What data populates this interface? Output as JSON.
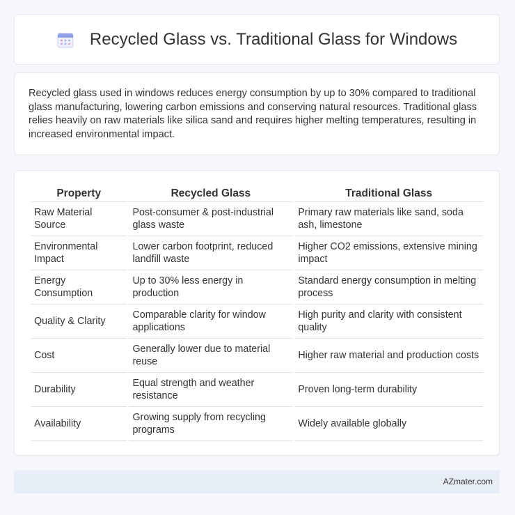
{
  "header": {
    "title": "Recycled Glass vs. Traditional Glass for Windows",
    "icon": "calendar-icon"
  },
  "intro": {
    "text": "Recycled glass used in windows reduces energy consumption by up to 30% compared to traditional glass manufacturing, lowering carbon emissions and conserving natural resources. Traditional glass relies heavily on raw materials like silica sand and requires higher melting temperatures, resulting in increased environmental impact."
  },
  "table": {
    "headers": [
      "Property",
      "Recycled Glass",
      "Traditional Glass"
    ],
    "rows": [
      [
        "Raw Material Source",
        "Post-consumer & post-industrial glass waste",
        "Primary raw materials like sand, soda ash, limestone"
      ],
      [
        "Environmental Impact",
        "Lower carbon footprint, reduced landfill waste",
        "Higher CO2 emissions, extensive mining impact"
      ],
      [
        "Energy Consumption",
        "Up to 30% less energy in production",
        "Standard energy consumption in melting process"
      ],
      [
        "Quality & Clarity",
        "Comparable clarity for window applications",
        "High purity and clarity with consistent quality"
      ],
      [
        "Cost",
        "Generally lower due to material reuse",
        "Higher raw material and production costs"
      ],
      [
        "Durability",
        "Equal strength and weather resistance",
        "Proven long-term durability"
      ],
      [
        "Availability",
        "Growing supply from recycling programs",
        "Widely available globally"
      ]
    ]
  },
  "footer": {
    "text": "AZmater.com"
  },
  "colors": {
    "page_bg": "#f5f7fb",
    "card_bg": "#ffffff",
    "footer_bg": "#e8eef8",
    "icon_accent": "#7b8fe0"
  }
}
